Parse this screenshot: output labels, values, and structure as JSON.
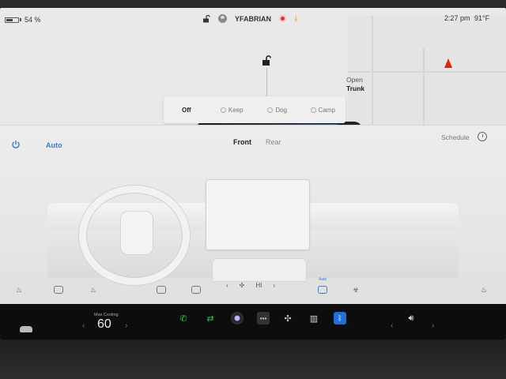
{
  "status_bar": {
    "battery_percent": "54 %",
    "battery_level": 0.54,
    "username": "YFABRIAN",
    "time": "2:27 pm",
    "outside_temp": "91°F"
  },
  "trunk": {
    "line1": "Open",
    "line2": "Trunk"
  },
  "climate_modes": [
    {
      "label": "Off",
      "active": true
    },
    {
      "label": "Keep",
      "active": false
    },
    {
      "label": "Dog",
      "active": false
    },
    {
      "label": "Camp",
      "active": false
    }
  ],
  "climate": {
    "auto_label": "Auto",
    "tab_front": "Front",
    "tab_rear": "Rear",
    "schedule_label": "Schedule",
    "fan_speed": "HI",
    "auto_small": "Auto"
  },
  "dock": {
    "temp_label": "Max Cooling",
    "temp_value": "60"
  },
  "colors": {
    "accent_blue": "#3a7bd5",
    "record_red": "#d33",
    "phone_green": "#2bc24a",
    "bluetooth_blue": "#1f6fd6"
  }
}
